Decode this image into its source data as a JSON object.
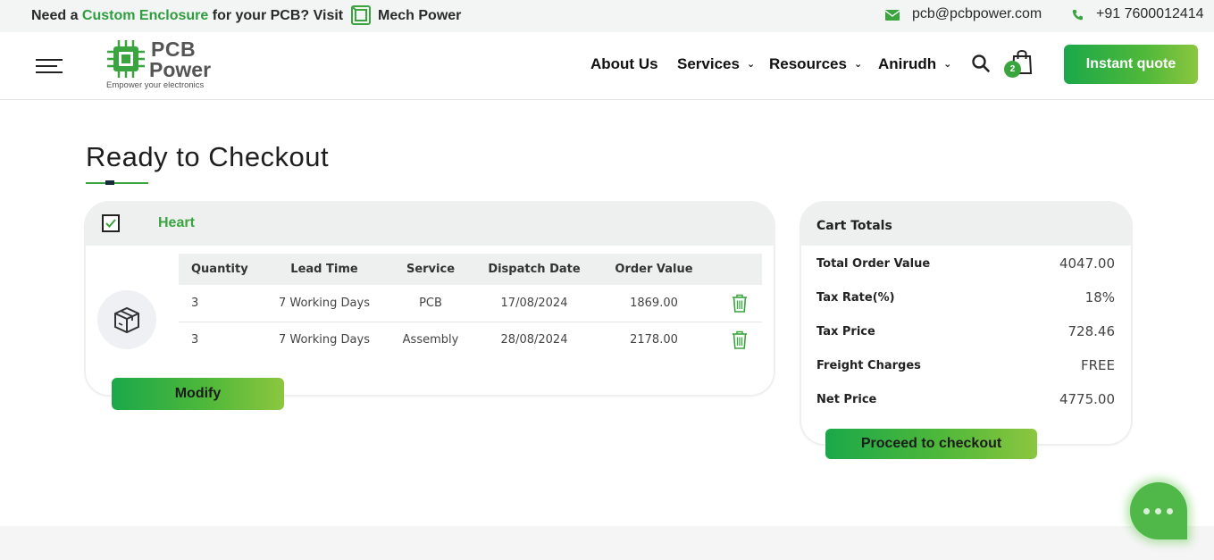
{
  "topbar": {
    "promo_prefix": "Need a",
    "promo_highlight": "Custom Enclosure",
    "promo_middle": "for your PCB? Visit",
    "promo_brand": "Mech Power",
    "email": "pcb@pcbpower.com",
    "phone": "+91 7600012414"
  },
  "header": {
    "logo_line1": "PCB",
    "logo_line2": "Power",
    "logo_tagline": "Empower your electronics",
    "nav": [
      {
        "label": "About Us"
      },
      {
        "label": "Services"
      },
      {
        "label": "Resources"
      },
      {
        "label": "Anirudh"
      }
    ],
    "cart_count": "2",
    "quote_label": "Instant quote"
  },
  "page": {
    "title": "Ready to Checkout"
  },
  "product": {
    "name": "Heart",
    "checked": true,
    "columns": [
      "Quantity",
      "Lead Time",
      "Service",
      "Dispatch Date",
      "Order Value"
    ],
    "rows": [
      {
        "quantity": "3",
        "lead_time": "7 Working Days",
        "service": "PCB",
        "dispatch_date": "17/08/2024",
        "order_value": "1869.00"
      },
      {
        "quantity": "3",
        "lead_time": "7 Working Days",
        "service": "Assembly",
        "dispatch_date": "28/08/2024",
        "order_value": "2178.00"
      }
    ],
    "modify_label": "Modify"
  },
  "totals": {
    "title": "Cart Totals",
    "rows": [
      {
        "label": "Total Order Value",
        "value": "4047.00"
      },
      {
        "label": "Tax Rate(%)",
        "value": "18%"
      },
      {
        "label": "Tax Price",
        "value": "728.46"
      },
      {
        "label": "Freight Charges",
        "value": "FREE"
      },
      {
        "label": "Net Price",
        "value": "4775.00"
      }
    ],
    "checkout_label": "Proceed to checkout"
  },
  "colors": {
    "accent": "#3aa53f",
    "header_bg": "#eef0ef"
  },
  "icons": [
    "menu-icon",
    "chip-logo-icon",
    "mech-power-icon",
    "envelope-icon",
    "phone-icon",
    "search-icon",
    "shopping-bag-icon",
    "checkbox-icon",
    "box-icon",
    "trash-icon",
    "chat-icon"
  ]
}
